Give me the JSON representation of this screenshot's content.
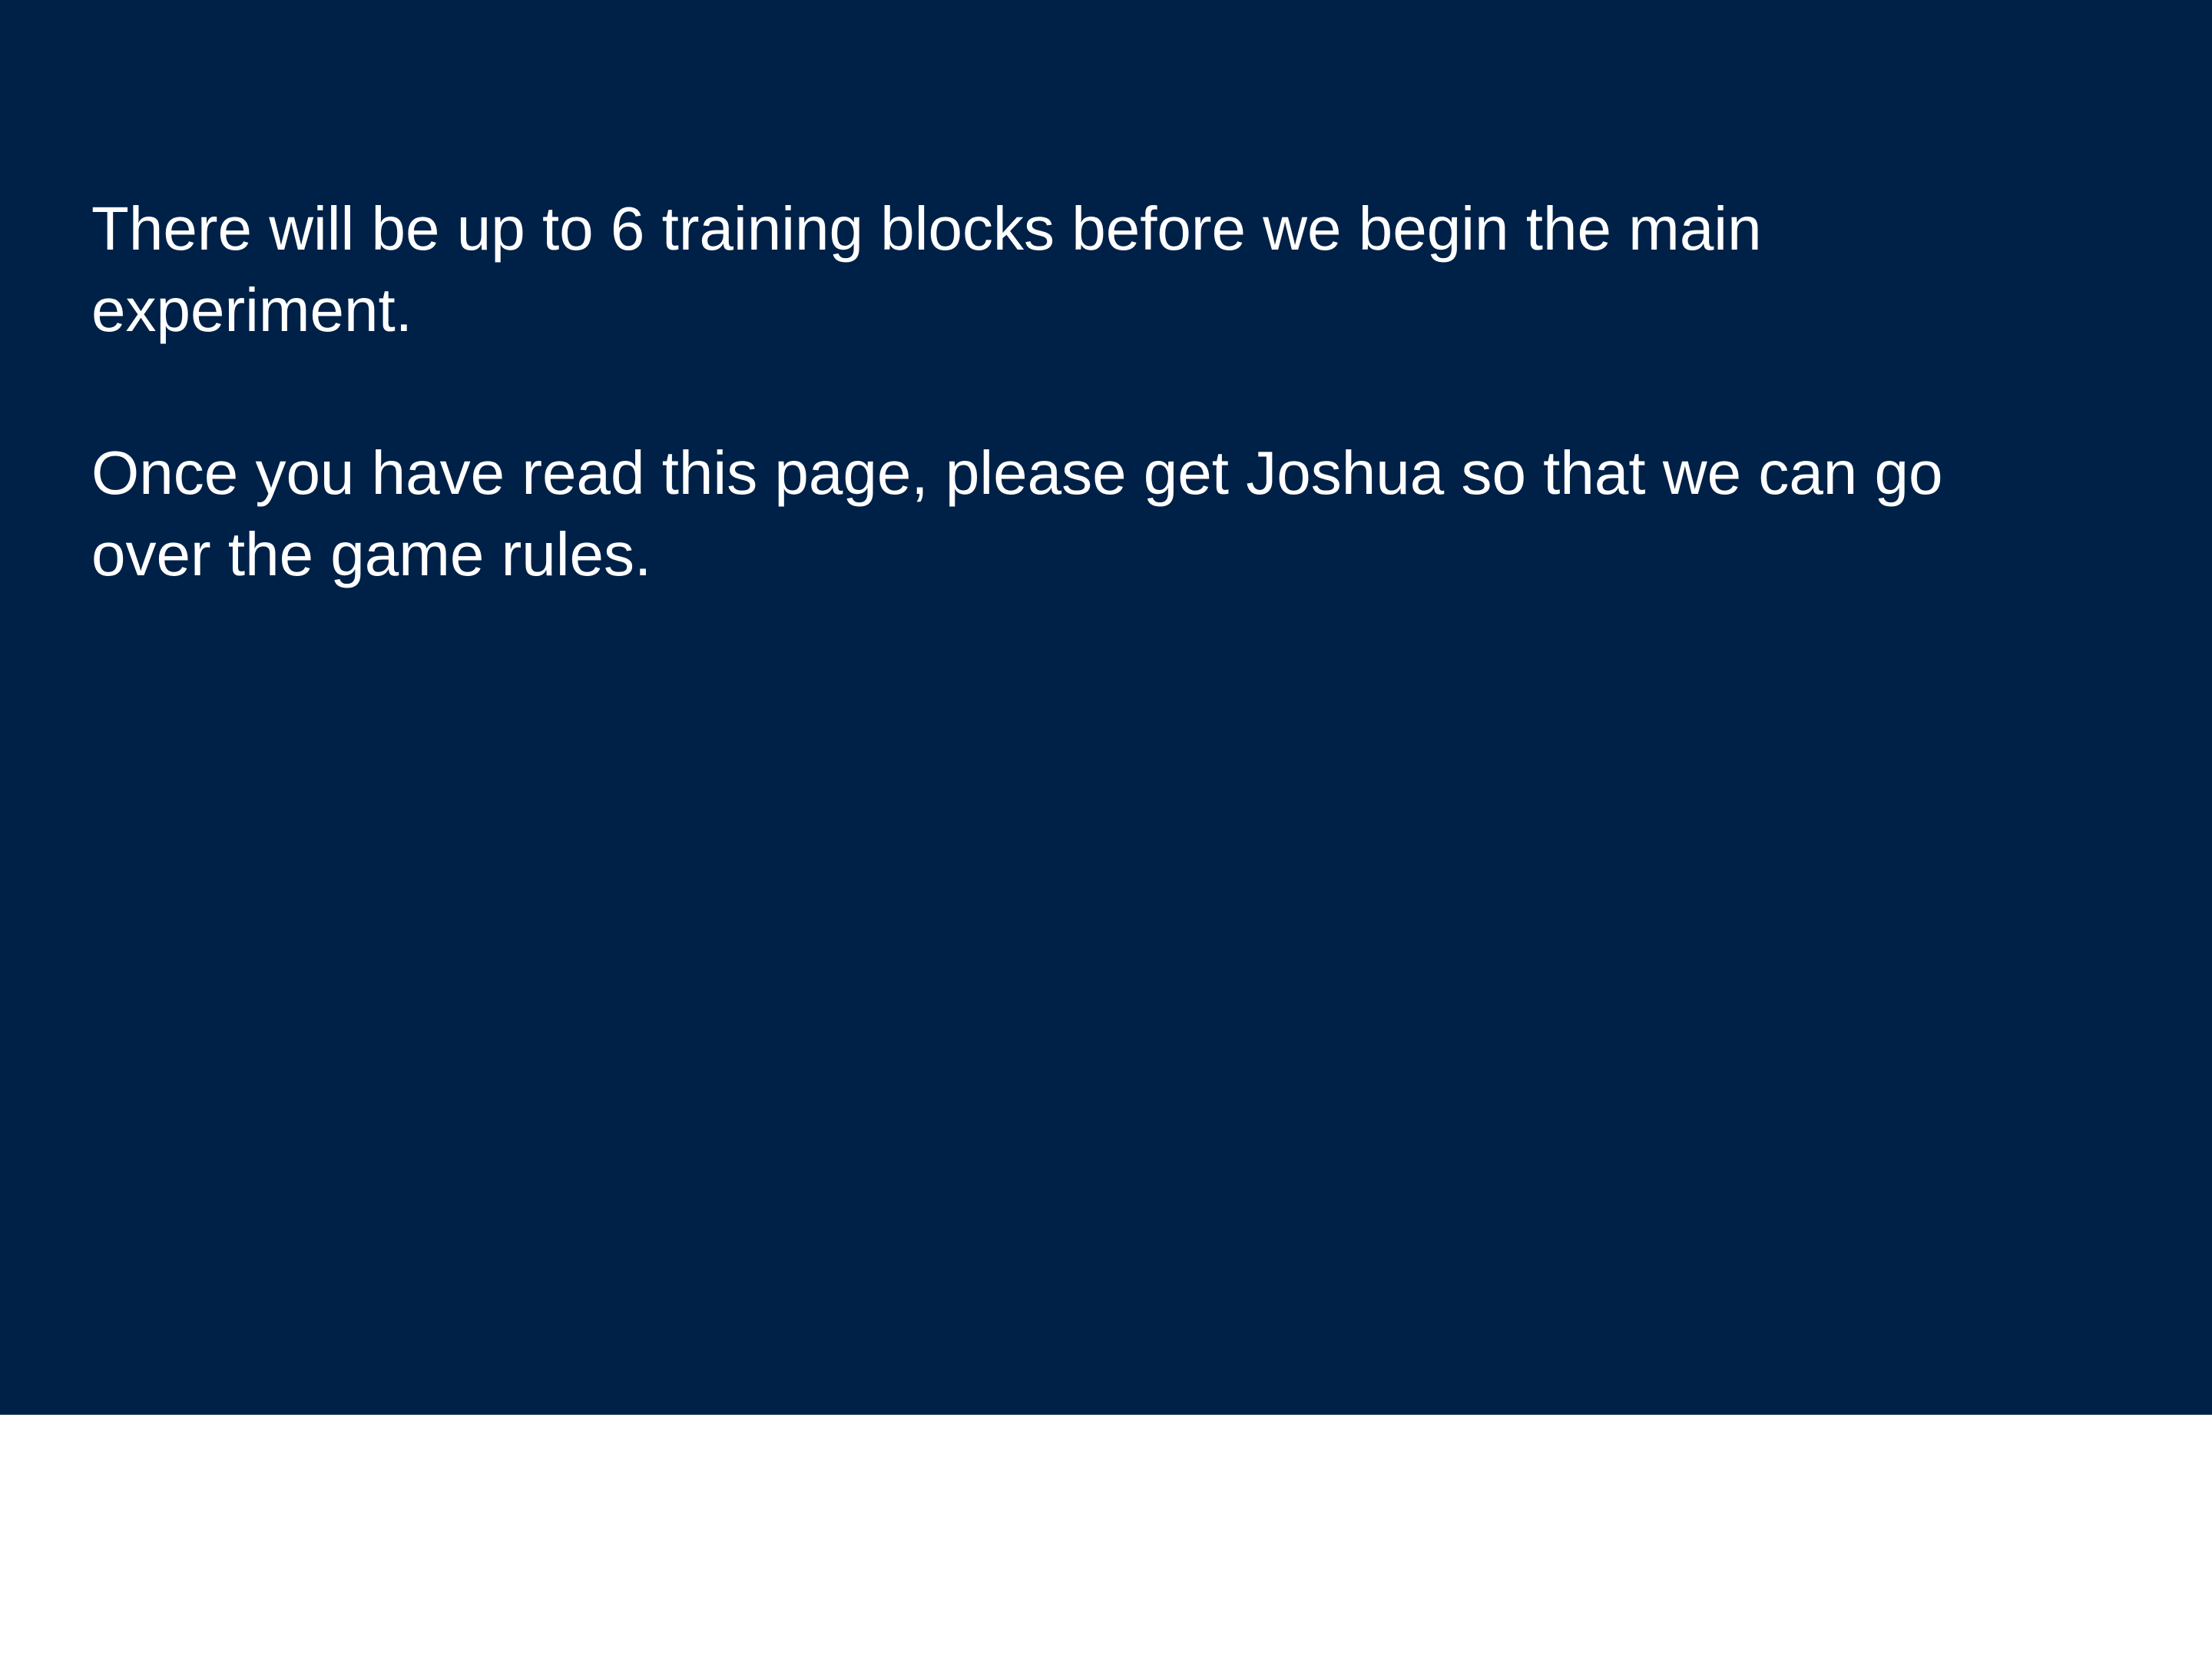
{
  "slide": {
    "background_color": "#002147",
    "text_color": "#ffffff",
    "paragraphs": [
      "There will be up to 6 training blocks before we begin the main experiment.",
      "Once you have read this page, please get Joshua so that we can go over the game rules."
    ]
  }
}
